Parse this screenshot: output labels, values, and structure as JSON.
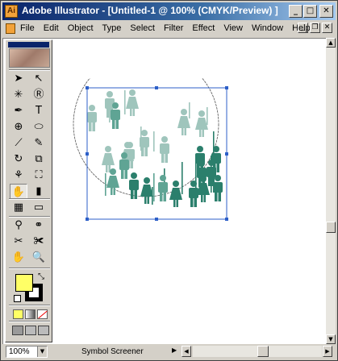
{
  "window": {
    "title": "Adobe Illustrator - [Untitled-1 @ 100% (CMYK/Preview) ]",
    "app_icon": "Ai",
    "buttons": {
      "minimize": "_",
      "maximize": "□",
      "close": "✕"
    }
  },
  "menu": {
    "items": [
      "File",
      "Edit",
      "Object",
      "Type",
      "Select",
      "Filter",
      "Effect",
      "View",
      "Window",
      "Help"
    ],
    "mdi_buttons": {
      "minimize": "_",
      "restore": "❐",
      "close": "✕"
    }
  },
  "toolbox": {
    "tools": [
      {
        "name": "selection",
        "glyph": "➤",
        "icon": "arrow-icon"
      },
      {
        "name": "direct-selection",
        "glyph": "↖",
        "icon": "hollow-arrow-icon"
      },
      {
        "name": "magic-wand",
        "glyph": "✳",
        "icon": "magic-wand-icon"
      },
      {
        "name": "lasso",
        "glyph": "Ⓡ",
        "icon": "lasso-icon"
      },
      {
        "name": "pen",
        "glyph": "✒",
        "icon": "pen-icon"
      },
      {
        "name": "type",
        "glyph": "T",
        "icon": "type-icon"
      },
      {
        "name": "spiral",
        "glyph": "⊕",
        "icon": "spiral-icon"
      },
      {
        "name": "ellipse",
        "glyph": "⬭",
        "icon": "ellipse-icon"
      },
      {
        "name": "paintbrush",
        "glyph": "⟋",
        "icon": "brush-icon"
      },
      {
        "name": "pencil",
        "glyph": "✎",
        "icon": "pencil-icon"
      },
      {
        "name": "rotate",
        "glyph": "↻",
        "icon": "rotate-icon"
      },
      {
        "name": "scale",
        "glyph": "⧉",
        "icon": "scale-icon"
      },
      {
        "name": "warp",
        "glyph": "⚘",
        "icon": "warp-icon"
      },
      {
        "name": "free-transform",
        "glyph": "⛶",
        "icon": "free-transform-icon"
      },
      {
        "name": "symbol-sprayer",
        "glyph": "✋",
        "icon": "symbol-sprayer-icon"
      },
      {
        "name": "graph",
        "glyph": "▮",
        "icon": "graph-icon"
      },
      {
        "name": "mesh",
        "glyph": "▦",
        "icon": "mesh-icon"
      },
      {
        "name": "gradient",
        "glyph": "▭",
        "icon": "gradient-icon"
      },
      {
        "name": "eyedropper",
        "glyph": "⚲",
        "icon": "eyedropper-icon"
      },
      {
        "name": "blend",
        "glyph": "⚭",
        "icon": "blend-icon"
      },
      {
        "name": "slice",
        "glyph": "✂",
        "icon": "slice-icon"
      },
      {
        "name": "scissors",
        "glyph": "✀",
        "icon": "scissors-icon"
      },
      {
        "name": "hand",
        "glyph": "✋",
        "icon": "hand-icon"
      },
      {
        "name": "zoom",
        "glyph": "🔍",
        "icon": "zoom-icon"
      }
    ],
    "fill_color": "#ffff66",
    "stroke_color": "#000000"
  },
  "canvas": {
    "people_colors": {
      "light": "#9fc5bc",
      "mid": "#5fa494",
      "dark": "#2b7f6c"
    },
    "selection_color": "#2d5fc8"
  },
  "status": {
    "zoom": "100%",
    "current_tool": "Symbol Screener"
  }
}
